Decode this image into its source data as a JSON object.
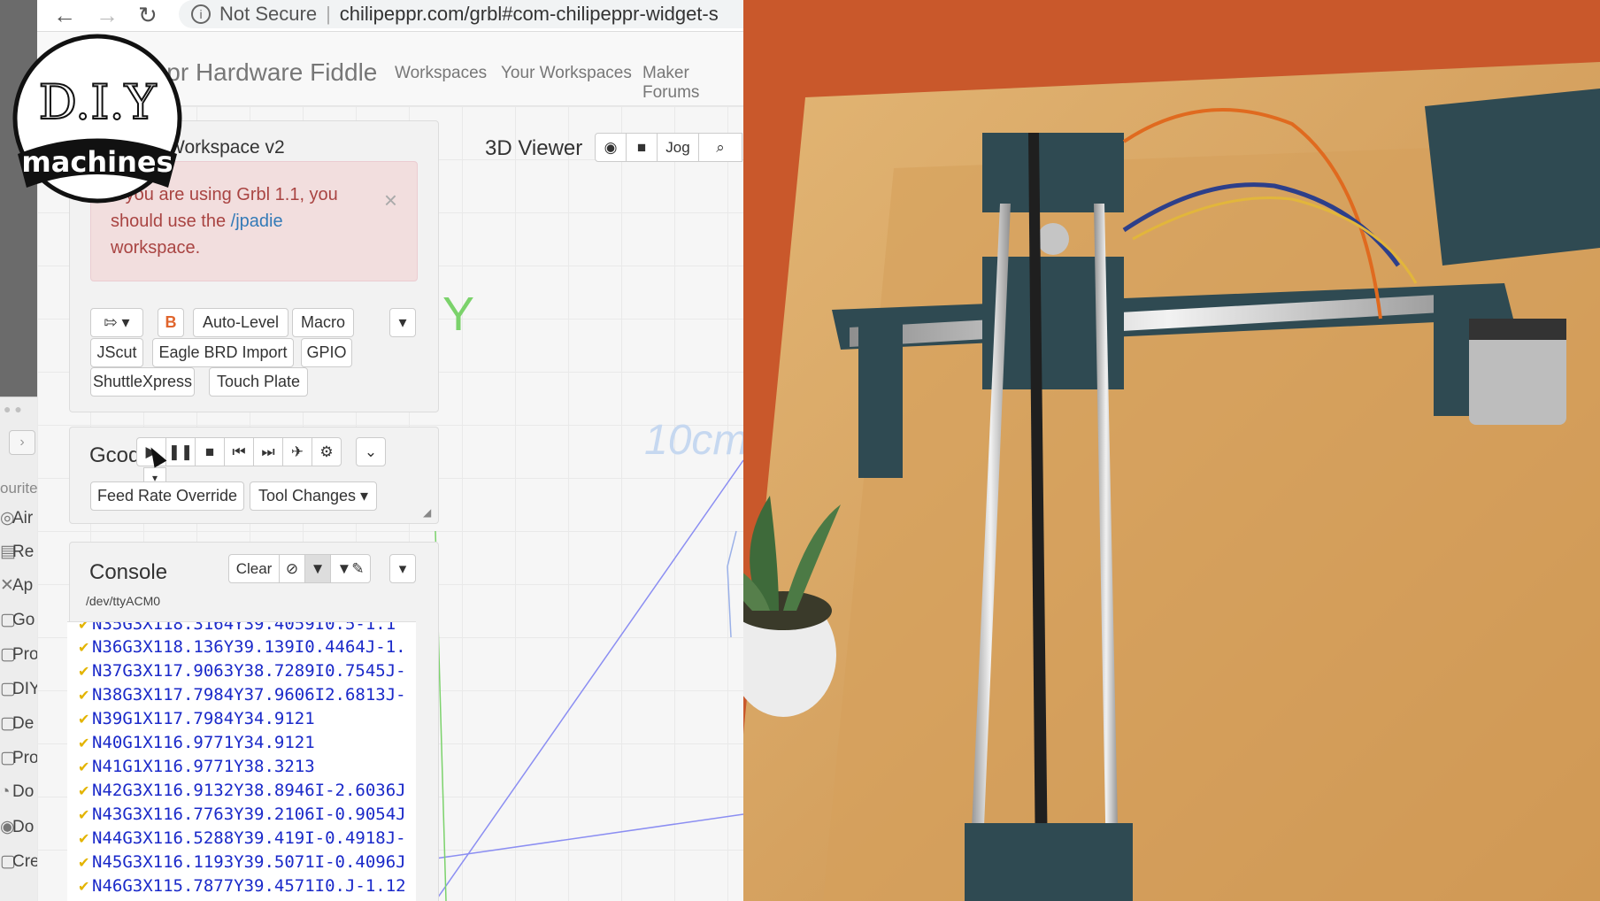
{
  "background_app": {
    "favourites_title": "ourite",
    "sidebar_items": [
      {
        "icon": "airdrop-icon",
        "label": "Air"
      },
      {
        "icon": "recents-icon",
        "label": "Re"
      },
      {
        "icon": "applications-icon",
        "label": "Ap"
      },
      {
        "icon": "folder-icon",
        "label": "Go"
      },
      {
        "icon": "folder-icon",
        "label": "Pro"
      },
      {
        "icon": "folder-icon",
        "label": "DIY"
      },
      {
        "icon": "folder-icon",
        "label": "De"
      },
      {
        "icon": "folder-icon",
        "label": "Pro"
      },
      {
        "icon": "documents-icon",
        "label": "Do"
      },
      {
        "icon": "downloads-icon",
        "label": "Do"
      },
      {
        "icon": "folder-icon",
        "label": "Cre"
      }
    ]
  },
  "browser": {
    "security_label": "Not Secure",
    "url": "chilipeppr.com/grbl#com-chilipeppr-widget-s"
  },
  "header": {
    "title": "ChiliPeppr Hardware Fiddle",
    "nav": [
      "Workspaces",
      "Your Workspaces",
      "Maker Forums"
    ]
  },
  "workspace_panel": {
    "title": "Workspace v2",
    "alert": {
      "text_before": "If you are using Grbl 1.1, you should use the ",
      "link": "/jpadie",
      "text_after": " workspace."
    },
    "buttons_row1": [
      "Auto-Level",
      "Macro"
    ],
    "buttons_row2": [
      "JScut",
      "Eagle BRD Import",
      "GPIO"
    ],
    "buttons_row3": [
      "ShuttleXpress",
      "Touch Plate"
    ]
  },
  "viewer": {
    "title": "3D Viewer",
    "jog_label": "Jog",
    "axis_y": "Y",
    "scale_label": "10cm"
  },
  "gcode_panel": {
    "title": "Gcode",
    "feed_rate_button": "Feed Rate Override",
    "tool_changes_button": "Tool Changes"
  },
  "console": {
    "title": "Console",
    "clear_label": "Clear",
    "port": "/dev/ttyACM0",
    "lines": [
      "N35G3X118.3164Y39.4059I0.5-1.1",
      "N36G3X118.136Y39.139I0.4464J-1.",
      "N37G3X117.9063Y38.7289I0.7545J-",
      "N38G3X117.7984Y37.9606I2.6813J-",
      "N39G1X117.7984Y34.9121",
      "N40G1X116.9771Y34.9121",
      "N41G1X116.9771Y38.3213",
      "N42G3X116.9132Y38.8946I-2.6036J",
      "N43G3X116.7763Y39.2106I-0.9054J",
      "N44G3X116.5288Y39.419I-0.4918J-",
      "N45G3X116.1193Y39.5071I-0.4096J",
      "N46G3X115.7877Y39.4571I0.J-1.12"
    ]
  },
  "logo": {
    "top_text": "D.I.Y",
    "banner_text": "machines"
  },
  "colors": {
    "alert_bg": "#f2dede",
    "alert_text": "#a94442",
    "link": "#337ab7",
    "console_text": "#1a29c9",
    "check": "#e3b400",
    "axis_y": "#7bd26b",
    "backdrop": "#c9582b",
    "table_wood": "#d8a560"
  }
}
